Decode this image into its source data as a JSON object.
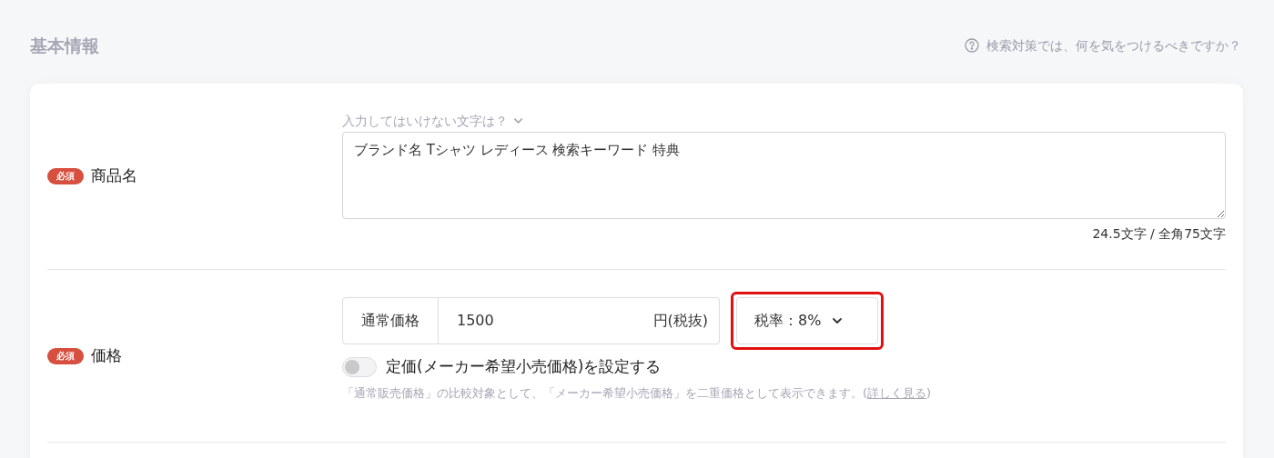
{
  "section": {
    "title": "基本情報",
    "help_link": "検索対策では、何を気をつけるべきですか？"
  },
  "product_name": {
    "required_badge": "必須",
    "label": "商品名",
    "hint": "入力してはいけない文字は？",
    "value": "ブランド名 Tシャツ レディース 検索キーワード 特典",
    "counter": "24.5文字 / 全角75文字"
  },
  "price": {
    "required_badge": "必須",
    "label": "価格",
    "field_label": "通常価格",
    "value": "1500",
    "unit": "円(税抜)",
    "tax_rate": {
      "label": "税率：8%",
      "highlighted": true
    },
    "list_price_toggle": {
      "label": "定価(メーカー希望小売価格)を設定する",
      "on": false
    },
    "note": "「通常販売価格」の比較対象として、「メーカー希望小売価格」を二重価格として表示できます。(",
    "note_link": "詳しく見る",
    "note_end": ")"
  }
}
